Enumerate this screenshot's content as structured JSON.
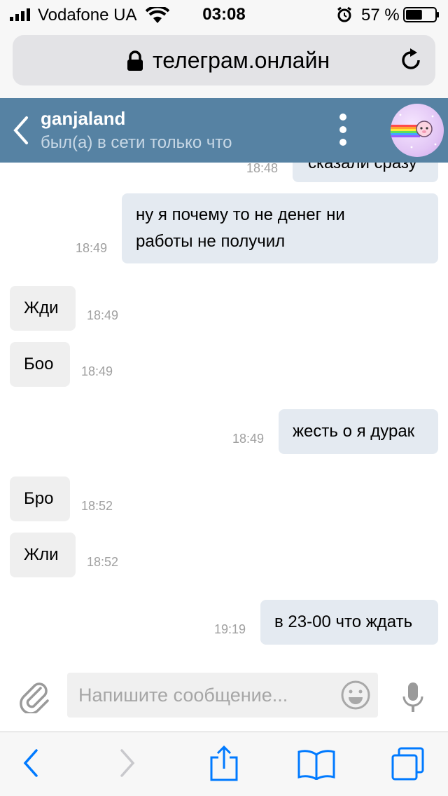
{
  "status_bar": {
    "carrier": "Vodafone UA",
    "time": "03:08",
    "battery_percent": "57 %",
    "battery_level": 0.57,
    "icons": [
      "signal-icon",
      "wifi-icon",
      "alarm-icon",
      "battery-icon"
    ]
  },
  "browser": {
    "url": "телеграм.онлайн",
    "icons": [
      "lock-icon",
      "reload-icon"
    ]
  },
  "chat_header": {
    "contact_name": "ganjaland",
    "contact_status": "был(а) в сети только что",
    "background_color": "#5682a3",
    "icons": [
      "back-icon",
      "menu-icon",
      "avatar"
    ]
  },
  "messages": [
    {
      "direction": "out",
      "text": "сказали сразу",
      "time": "18:48",
      "partially_hidden": true
    },
    {
      "direction": "out",
      "lines": [
        "ну я почему то не денег ни",
        "работы не получил"
      ],
      "time": "18:49"
    },
    {
      "direction": "in",
      "text": "Жди",
      "time": "18:49"
    },
    {
      "direction": "in",
      "text": "Боо",
      "time": "18:49"
    },
    {
      "direction": "out",
      "text": "жесть о я дурак",
      "time": "18:49"
    },
    {
      "direction": "in",
      "text": "Бро",
      "time": "18:52"
    },
    {
      "direction": "in",
      "text": "Жли",
      "time": "18:52"
    },
    {
      "direction": "out",
      "text": "в 23-00 что ждать",
      "time": "19:19"
    }
  ],
  "composer": {
    "placeholder": "Напишите сообщение...",
    "icons": [
      "attach-icon",
      "emoji-icon",
      "mic-icon"
    ]
  },
  "toolbar": {
    "icons": [
      "back-icon",
      "forward-icon",
      "share-icon",
      "bookmarks-icon",
      "tabs-icon"
    ],
    "accent_color": "#007aff"
  }
}
